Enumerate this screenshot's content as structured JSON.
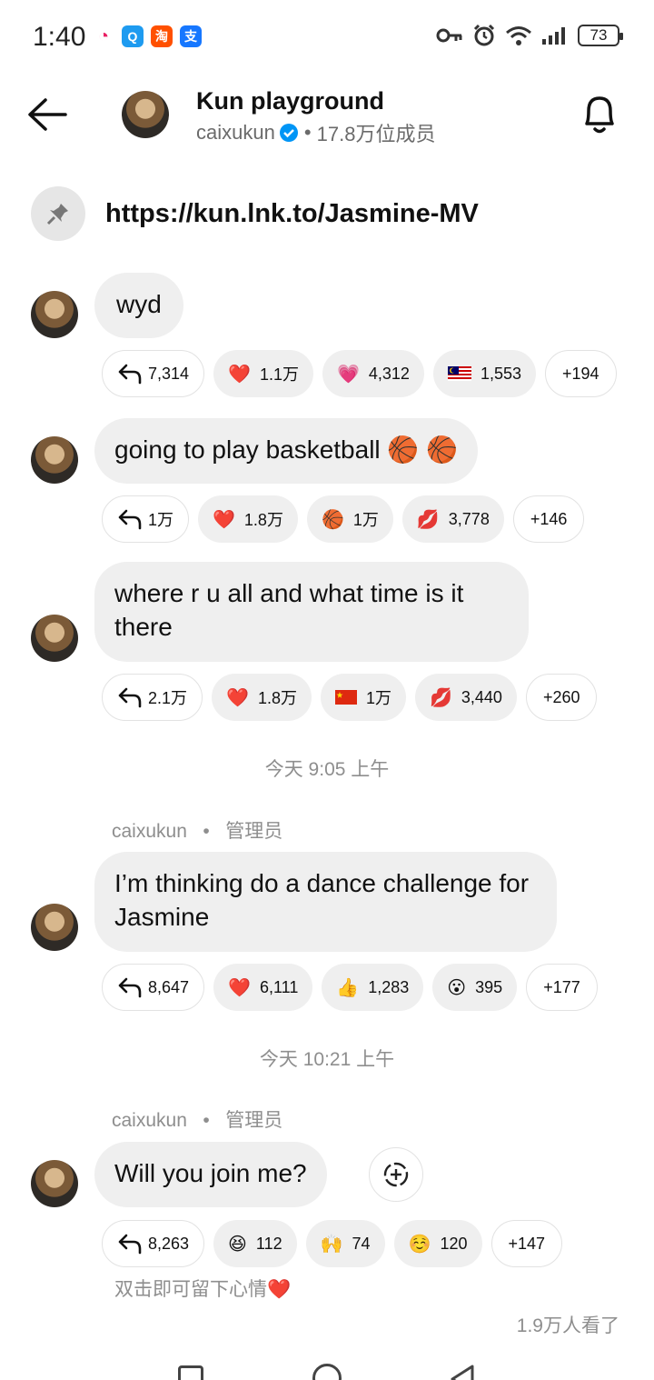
{
  "status_bar": {
    "time": "1:40",
    "battery": "73",
    "apps": [
      {
        "icon": "china-mobile-icon",
        "color": "#ffffff",
        "glyph": "◔"
      },
      {
        "icon": "qq-browser-icon",
        "color": "#1e9bf0",
        "glyph": "Q"
      },
      {
        "icon": "taobao-icon",
        "color": "#ff5000",
        "glyph": "淘"
      },
      {
        "icon": "alipay-icon",
        "color": "#1677ff",
        "glyph": "支"
      }
    ]
  },
  "header": {
    "title": "Kun playground",
    "username": "caixukun",
    "separator": "•",
    "members": "17.8万位成员"
  },
  "pinned": {
    "link": "https://kun.lnk.to/Jasmine-MV"
  },
  "messages": [
    {
      "text": "wyd",
      "reply_count": "7,314",
      "reactions": [
        {
          "emoji": "❤️",
          "count": "1.1万"
        },
        {
          "emoji": "💗",
          "count": "4,312"
        },
        {
          "emoji": "🇲🇾",
          "count": "1,553"
        }
      ],
      "more": "+194"
    },
    {
      "text": "going to play basketball 🏀 🏀",
      "reply_count": "1万",
      "reactions": [
        {
          "emoji": "❤️",
          "count": "1.8万"
        },
        {
          "emoji": "🏀",
          "count": "1万"
        },
        {
          "emoji": "💋",
          "count": "3,778"
        }
      ],
      "more": "+146"
    },
    {
      "text": "where r u all and what time is it there",
      "reply_count": "2.1万",
      "reactions": [
        {
          "emoji": "❤️",
          "count": "1.8万"
        },
        {
          "emoji": "🇨🇳",
          "count": "1万"
        },
        {
          "emoji": "💋",
          "count": "3,440"
        }
      ],
      "more": "+260"
    },
    {
      "text": "I’m thinking do a dance challenge for Jasmine",
      "reply_count": "8,647",
      "reactions": [
        {
          "emoji": "❤️",
          "count": "6,111"
        },
        {
          "emoji": "👍",
          "count": "1,283"
        },
        {
          "emoji": "😮",
          "count": "395"
        }
      ],
      "more": "+177"
    },
    {
      "text": "Will you join me?",
      "reply_count": "8,263",
      "reactions": [
        {
          "emoji": "😆",
          "count": "112"
        },
        {
          "emoji": "🙌",
          "count": "74"
        },
        {
          "emoji": "☺️",
          "count": "120"
        }
      ],
      "more": "+147"
    }
  ],
  "time_separators": [
    "今天 9:05 上午",
    "今天 10:21 上午"
  ],
  "sender": {
    "name": "caixukun",
    "dot": "•",
    "role": "管理员"
  },
  "hint": "双击即可留下心情❤️",
  "seen": "1.9万人看了"
}
